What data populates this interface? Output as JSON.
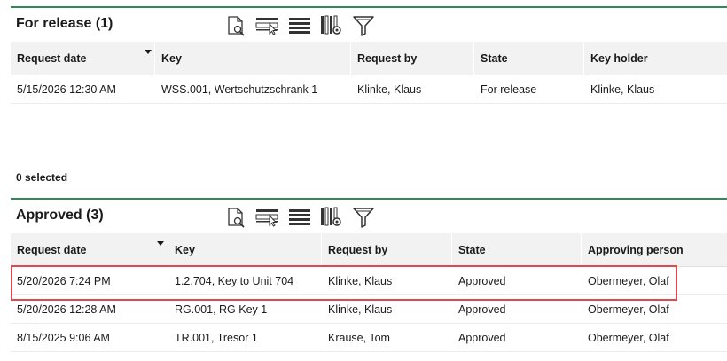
{
  "release_panel": {
    "title": "For release (1)",
    "columns": [
      "Request date",
      "Key",
      "Request by",
      "State",
      "Key holder"
    ],
    "rows": [
      [
        "5/15/2026 12:30 AM",
        "WSS.001, Wertschutzschrank 1",
        "Klinke, Klaus",
        "For release",
        "Klinke, Klaus"
      ]
    ],
    "selected_text": "0 selected"
  },
  "approved_panel": {
    "title": "Approved (3)",
    "columns": [
      "Request date",
      "Key",
      "Request by",
      "State",
      "Approving person"
    ],
    "rows": [
      [
        "5/20/2026 7:24 PM",
        "1.2.704, Key to Unit 704",
        "Klinke, Klaus",
        "Approved",
        "Obermeyer, Olaf"
      ],
      [
        "5/20/2026 12:28 AM",
        "RG.001, RG Key 1",
        "Klinke, Klaus",
        "Approved",
        "Obermeyer, Olaf"
      ],
      [
        "8/15/2025 9:06 AM",
        "TR.001, Tresor 1",
        "Krause, Tom",
        "Approved",
        "Obermeyer, Olaf"
      ]
    ],
    "highlighted_row": 0
  },
  "toolbar_icons": [
    "document-search-icon",
    "row-select-icon",
    "list-rows-icon",
    "column-settings-icon",
    "filter-icon"
  ],
  "colors": {
    "section_rule": "#2e8b57",
    "highlight": "#e0484f",
    "header_bg": "#f2f2f2"
  }
}
